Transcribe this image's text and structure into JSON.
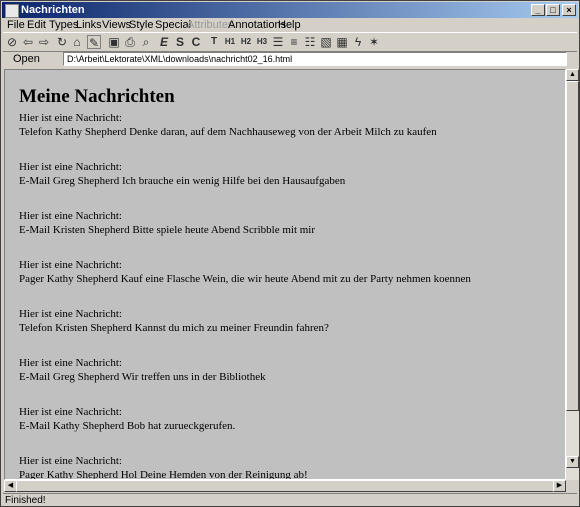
{
  "window": {
    "title": "Nachrichten"
  },
  "title_buttons": {
    "minimize": "_",
    "maximize": "□",
    "close": "×"
  },
  "menubar": [
    {
      "label": "File",
      "enabled": true
    },
    {
      "label": "Edit",
      "enabled": true
    },
    {
      "label": "Types",
      "enabled": true
    },
    {
      "label": "Links",
      "enabled": true
    },
    {
      "label": "Views",
      "enabled": true
    },
    {
      "label": "Style",
      "enabled": true
    },
    {
      "label": "Special",
      "enabled": true
    },
    {
      "label": "Attributes",
      "enabled": false
    },
    {
      "label": "Annotations",
      "enabled": true
    },
    {
      "label": "Help",
      "enabled": true
    }
  ],
  "toolbar": {
    "icons": [
      {
        "name": "stop-icon",
        "glyph": "⊘"
      },
      {
        "name": "back-icon",
        "glyph": "⇦"
      },
      {
        "name": "forward-icon",
        "glyph": "⇨"
      },
      {
        "name": "reload-icon",
        "glyph": "↻"
      },
      {
        "name": "home-icon",
        "glyph": "⌂"
      },
      {
        "name": "edit-toggle-icon",
        "glyph": "✎"
      },
      {
        "name": "save-icon",
        "glyph": "▣"
      },
      {
        "name": "print-icon",
        "glyph": "⎙"
      },
      {
        "name": "find-icon",
        "glyph": "⌕"
      },
      {
        "name": "emphasis-icon",
        "glyph": "E"
      },
      {
        "name": "strong-icon",
        "glyph": "S"
      },
      {
        "name": "code-icon",
        "glyph": "C"
      },
      {
        "name": "title-icon",
        "glyph": "T"
      },
      {
        "name": "h1-icon",
        "glyph": "H1"
      },
      {
        "name": "h2-icon",
        "glyph": "H2"
      },
      {
        "name": "h3-icon",
        "glyph": "H3"
      },
      {
        "name": "bullet-list-icon",
        "glyph": "☰"
      },
      {
        "name": "numbered-list-icon",
        "glyph": "≡"
      },
      {
        "name": "definition-list-icon",
        "glyph": "☷"
      },
      {
        "name": "image-icon",
        "glyph": "▧"
      },
      {
        "name": "table-icon",
        "glyph": "▦"
      },
      {
        "name": "link-icon",
        "glyph": "ϟ"
      },
      {
        "name": "math-icon",
        "glyph": "✶"
      }
    ]
  },
  "open_row": {
    "button_label": "Open",
    "path": "D:\\Arbeit\\Lektorate\\XML\\downloads\\nachricht02_16.html"
  },
  "document": {
    "heading": "Meine Nachrichten",
    "messages": [
      {
        "intro": "Hier ist eine Nachricht:",
        "body": "Telefon Kathy Shepherd Denke daran, auf dem Nachhauseweg von der Arbeit Milch zu kaufen"
      },
      {
        "intro": "Hier ist eine Nachricht:",
        "body": "E-Mail Greg Shepherd Ich brauche ein wenig Hilfe bei den Hausaufgaben"
      },
      {
        "intro": "Hier ist eine Nachricht:",
        "body": "E-Mail Kristen Shepherd Bitte spiele heute Abend Scribble mit mir"
      },
      {
        "intro": "Hier ist eine Nachricht:",
        "body": "Pager Kathy Shepherd Kauf eine Flasche Wein, die wir heute Abend mit zu der Party nehmen koennen"
      },
      {
        "intro": "Hier ist eine Nachricht:",
        "body": "Telefon Kristen Shepherd Kannst du mich zu meiner Freundin fahren?"
      },
      {
        "intro": "Hier ist eine Nachricht:",
        "body": "E-Mail Greg Shepherd Wir treffen uns in der Bibliothek"
      },
      {
        "intro": "Hier ist eine Nachricht:",
        "body": "E-Mail Kathy Shepherd Bob hat zurueckgerufen."
      },
      {
        "intro": "Hier ist eine Nachricht:",
        "body": "Pager Kathy Shepherd Hol Deine Hemden von der Reinigung ab!"
      }
    ]
  },
  "status_bar": {
    "text": "Finished!"
  }
}
